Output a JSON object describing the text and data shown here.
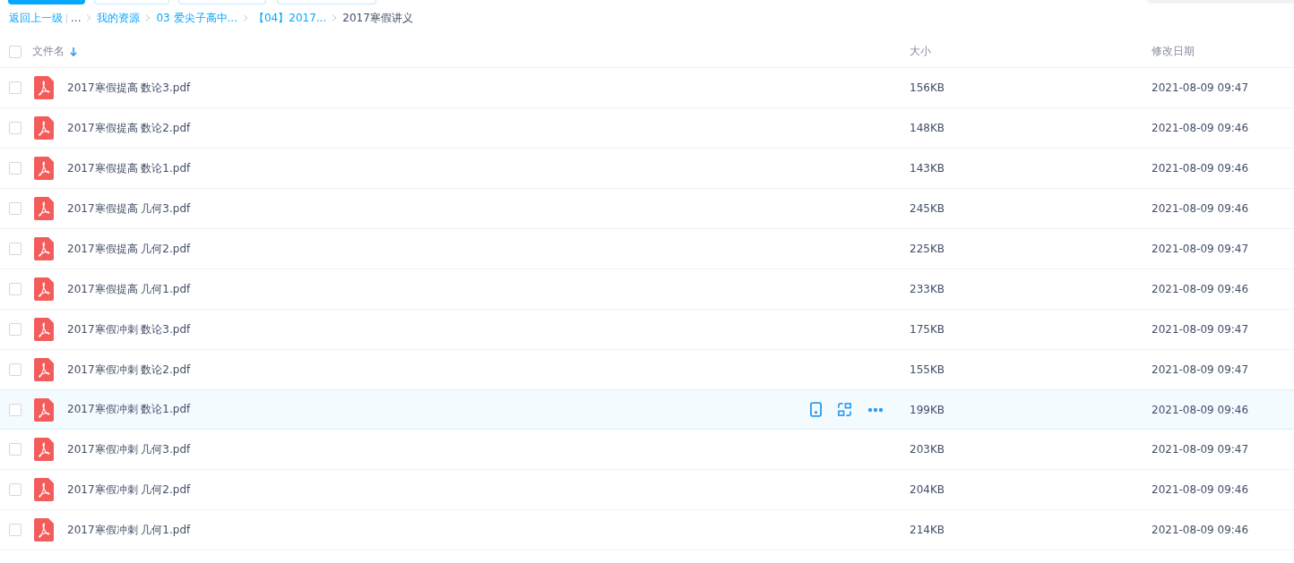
{
  "breadcrumb": [
    {
      "kind": "back",
      "label": "返回上一级"
    },
    {
      "kind": "ellipsis",
      "label": "..."
    },
    {
      "kind": "link",
      "label": "我的资源"
    },
    {
      "kind": "link",
      "label": "03 爱尖子高中..."
    },
    {
      "kind": "link",
      "label": "【04】2017..."
    },
    {
      "kind": "current",
      "label": "2017寒假讲义"
    }
  ],
  "table": {
    "all_checked": false,
    "columns": [
      {
        "label": "文件名",
        "sorted": true
      },
      {
        "label": "大小",
        "sorted": false
      },
      {
        "label": "修改日期",
        "sorted": false
      }
    ],
    "rows": [
      {
        "name": "2017寒假提高 数论3.pdf",
        "size": "156KB",
        "modified": "2021-08-09 09:47",
        "checked": false,
        "hovered": false
      },
      {
        "name": "2017寒假提高 数论2.pdf",
        "size": "148KB",
        "modified": "2021-08-09 09:46",
        "checked": false,
        "hovered": false
      },
      {
        "name": "2017寒假提高 数论1.pdf",
        "size": "143KB",
        "modified": "2021-08-09 09:46",
        "checked": false,
        "hovered": false
      },
      {
        "name": "2017寒假提高 几何3.pdf",
        "size": "245KB",
        "modified": "2021-08-09 09:46",
        "checked": false,
        "hovered": false
      },
      {
        "name": "2017寒假提高 几何2.pdf",
        "size": "225KB",
        "modified": "2021-08-09 09:47",
        "checked": false,
        "hovered": false
      },
      {
        "name": "2017寒假提高 几何1.pdf",
        "size": "233KB",
        "modified": "2021-08-09 09:46",
        "checked": false,
        "hovered": false
      },
      {
        "name": "2017寒假冲刺 数论3.pdf",
        "size": "175KB",
        "modified": "2021-08-09 09:47",
        "checked": false,
        "hovered": false
      },
      {
        "name": "2017寒假冲刺 数论2.pdf",
        "size": "155KB",
        "modified": "2021-08-09 09:47",
        "checked": false,
        "hovered": false
      },
      {
        "name": "2017寒假冲刺 数论1.pdf",
        "size": "199KB",
        "modified": "2021-08-09 09:46",
        "checked": false,
        "hovered": true
      },
      {
        "name": "2017寒假冲刺 几何3.pdf",
        "size": "203KB",
        "modified": "2021-08-09 09:47",
        "checked": false,
        "hovered": false
      },
      {
        "name": "2017寒假冲刺 几何2.pdf",
        "size": "204KB",
        "modified": "2021-08-09 09:46",
        "checked": false,
        "hovered": false
      },
      {
        "name": "2017寒假冲刺 几何1.pdf",
        "size": "214KB",
        "modified": "2021-08-09 09:46",
        "checked": false,
        "hovered": false
      }
    ]
  }
}
